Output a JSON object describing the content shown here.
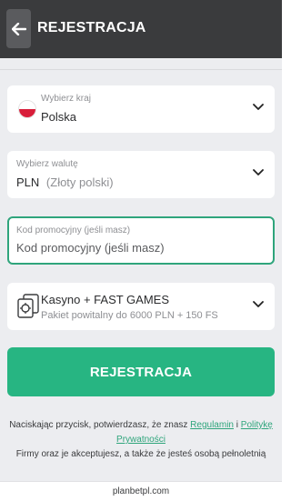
{
  "header": {
    "title": "REJESTRACJA"
  },
  "country": {
    "label": "Wybierz kraj",
    "value": "Polska"
  },
  "currency": {
    "label": "Wybierz walutę",
    "code": "PLN",
    "name": "(Złoty polski)"
  },
  "promo": {
    "label": "Kod promocyjny (jeśli masz)",
    "placeholder": "Kod promocyjny (jeśli masz)"
  },
  "bonus": {
    "title": "Kasyno + FAST GAMES",
    "subtitle": "Pakiet powitalny do 6000 PLN + 150 FS"
  },
  "submit": {
    "label": "REJESTRACJA"
  },
  "terms": {
    "prefix": "Naciskając przycisk, potwierdzasz, że znasz",
    "link1": "Regulamin",
    "conj": "i",
    "link2": "Politykę Prywatności",
    "suffix": "Firmy oraz je akceptujesz, a także że jesteś osobą pełnoletnią"
  },
  "footer": {
    "domain": "planbetpl.com"
  },
  "colors": {
    "accent": "#27b582",
    "header_bg": "#3a3b3d",
    "page_bg": "#ecedf0"
  }
}
